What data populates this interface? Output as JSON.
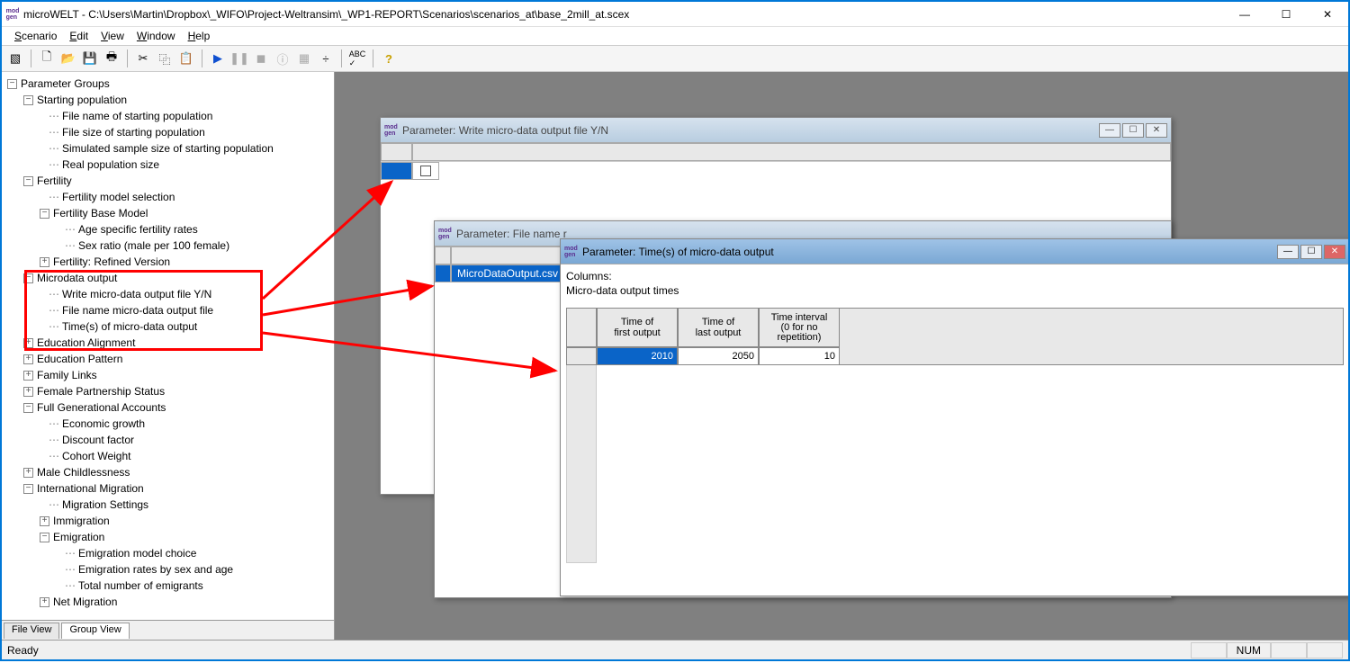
{
  "title": "microWELT - C:\\Users\\Martin\\Dropbox\\_WIFO\\Project-Weltransim\\_WP1-REPORT\\Scenarios\\scenarios_at\\base_2mill_at.scex",
  "menu": {
    "scenario": "Scenario",
    "edit": "Edit",
    "view": "View",
    "window": "Window",
    "help": "Help"
  },
  "tabs": {
    "file": "File View",
    "group": "Group View"
  },
  "status": {
    "ready": "Ready",
    "num": "NUM"
  },
  "tree": {
    "root": "Parameter Groups",
    "start_pop": "Starting population",
    "sp_file": "File name of starting population",
    "sp_size": "File size of starting population",
    "sp_sample": "Simulated sample size of starting population",
    "sp_real": "Real population size",
    "fertility": "Fertility",
    "f_sel": "Fertility model selection",
    "f_base": "Fertility Base Model",
    "f_age": "Age specific fertility rates",
    "f_sex": "Sex ratio (male per 100 female)",
    "f_ref": "Fertility: Refined Version",
    "micro": "Microdata output",
    "m_write": "Write micro-data output file Y/N",
    "m_fname": "File name micro-data output file",
    "m_time": "Time(s) of micro-data output",
    "edu_align": "Education Alignment",
    "edu_pat": "Education Pattern",
    "family": "Family Links",
    "fem_part": "Female Partnership Status",
    "full_gen": "Full Generational Accounts",
    "fg_econ": "Economic growth",
    "fg_disc": "Discount factor",
    "fg_cohort": "Cohort Weight",
    "male_child": "Male Childlessness",
    "intl_mig": "International Migration",
    "mig_set": "Migration Settings",
    "immig": "Immigration",
    "emig": "Emigration",
    "em_choice": "Emigration model choice",
    "em_rates": "Emigration rates by sex and age",
    "em_total": "Total number of emigrants",
    "net_mig": "Net Migration"
  },
  "win1": {
    "title": "Parameter: Write micro-data output file Y/N"
  },
  "win2": {
    "title": "Parameter: File name r",
    "value": "MicroDataOutput.csv"
  },
  "win3": {
    "title": "Parameter: Time(s) of micro-data output",
    "columns_lbl": "Columns:",
    "columns_desc": "Micro-data output times",
    "h1a": "Time of",
    "h1b": "first output",
    "h2a": "Time of",
    "h2b": "last output",
    "h3a": "Time interval",
    "h3b": "(0 for no",
    "h3c": "repetition)",
    "v1": "2010",
    "v2": "2050",
    "v3": "10"
  }
}
